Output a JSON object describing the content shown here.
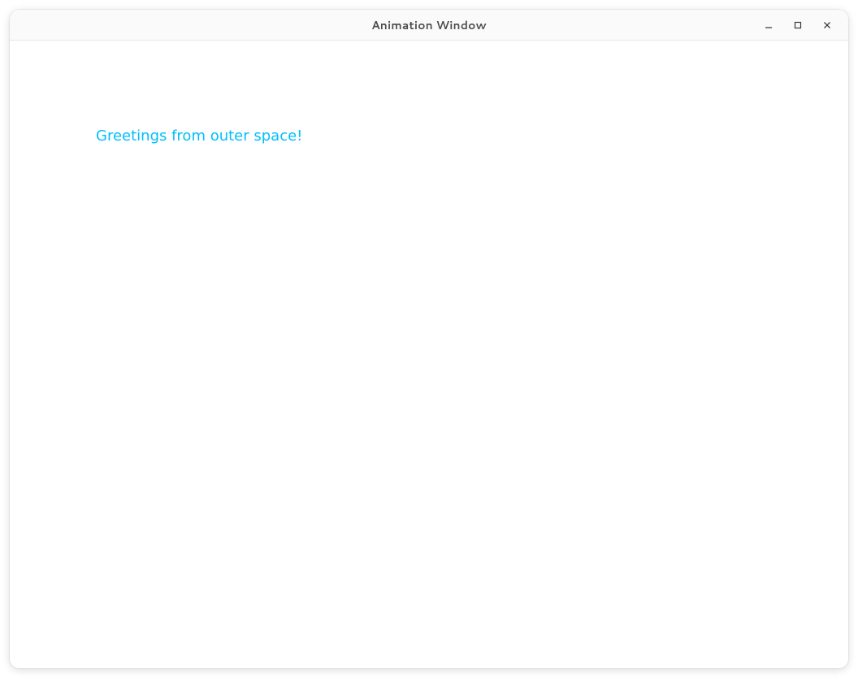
{
  "window": {
    "title": "Animation Window"
  },
  "content": {
    "greeting": "Greetings from outer space!",
    "text_color": "#00bfff"
  },
  "icons": {
    "minimize": "minimize-icon",
    "maximize": "maximize-icon",
    "close": "close-icon"
  }
}
